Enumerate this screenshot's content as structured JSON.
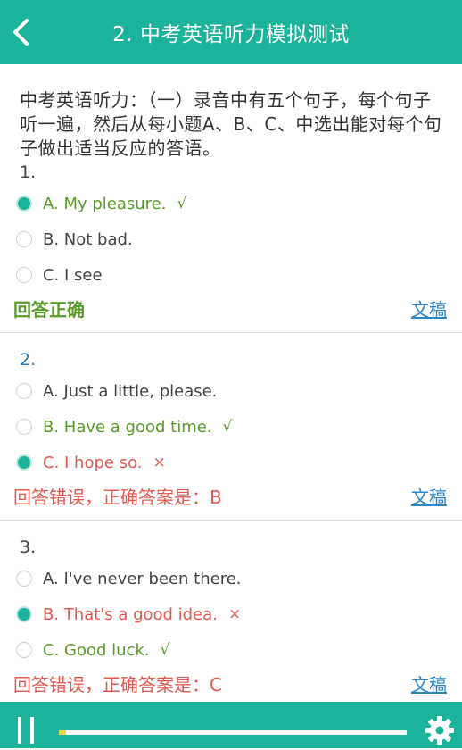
{
  "header": {
    "title": "2. 中考英语听力模拟测试",
    "back_icon": "chevron-left-icon"
  },
  "intro": "中考英语听力：（一）录音中有五个句子，每个句子听一遍，然后从每小题A、B、C、中选出能对每个句子做出适当反应的答语。",
  "doc_label": "文稿",
  "questions": [
    {
      "number": "1.",
      "options": [
        {
          "text": "A. My pleasure.",
          "mark": "√",
          "selected": true
        },
        {
          "text": "B. Not bad.",
          "mark": "",
          "selected": false
        },
        {
          "text": "C. I see",
          "mark": "",
          "selected": false
        }
      ],
      "result": "回答正确"
    },
    {
      "number": "2.",
      "options": [
        {
          "text": "A. Just a little, please.",
          "mark": "",
          "selected": false
        },
        {
          "text": "B. Have a good time.",
          "mark": "√",
          "selected": false
        },
        {
          "text": "C. I hope so.",
          "mark": "×",
          "selected": true
        }
      ],
      "result": "回答错误，正确答案是：B"
    },
    {
      "number": "3.",
      "options": [
        {
          "text": "A. I've never been there.",
          "mark": "",
          "selected": false
        },
        {
          "text": "B. That's a good idea.",
          "mark": "×",
          "selected": true
        },
        {
          "text": "C. Good luck.",
          "mark": "√",
          "selected": false
        }
      ],
      "result": "回答错误，正确答案是：C"
    }
  ],
  "player": {
    "progress": 0.02,
    "pause_icon": "pause-icon",
    "settings_icon": "gear-icon"
  },
  "colors": {
    "accent": "#1bb39a",
    "correct": "#5a9b2c",
    "wrong": "#e05a52",
    "link": "#2a86c8",
    "progress": "#e6d84a"
  }
}
